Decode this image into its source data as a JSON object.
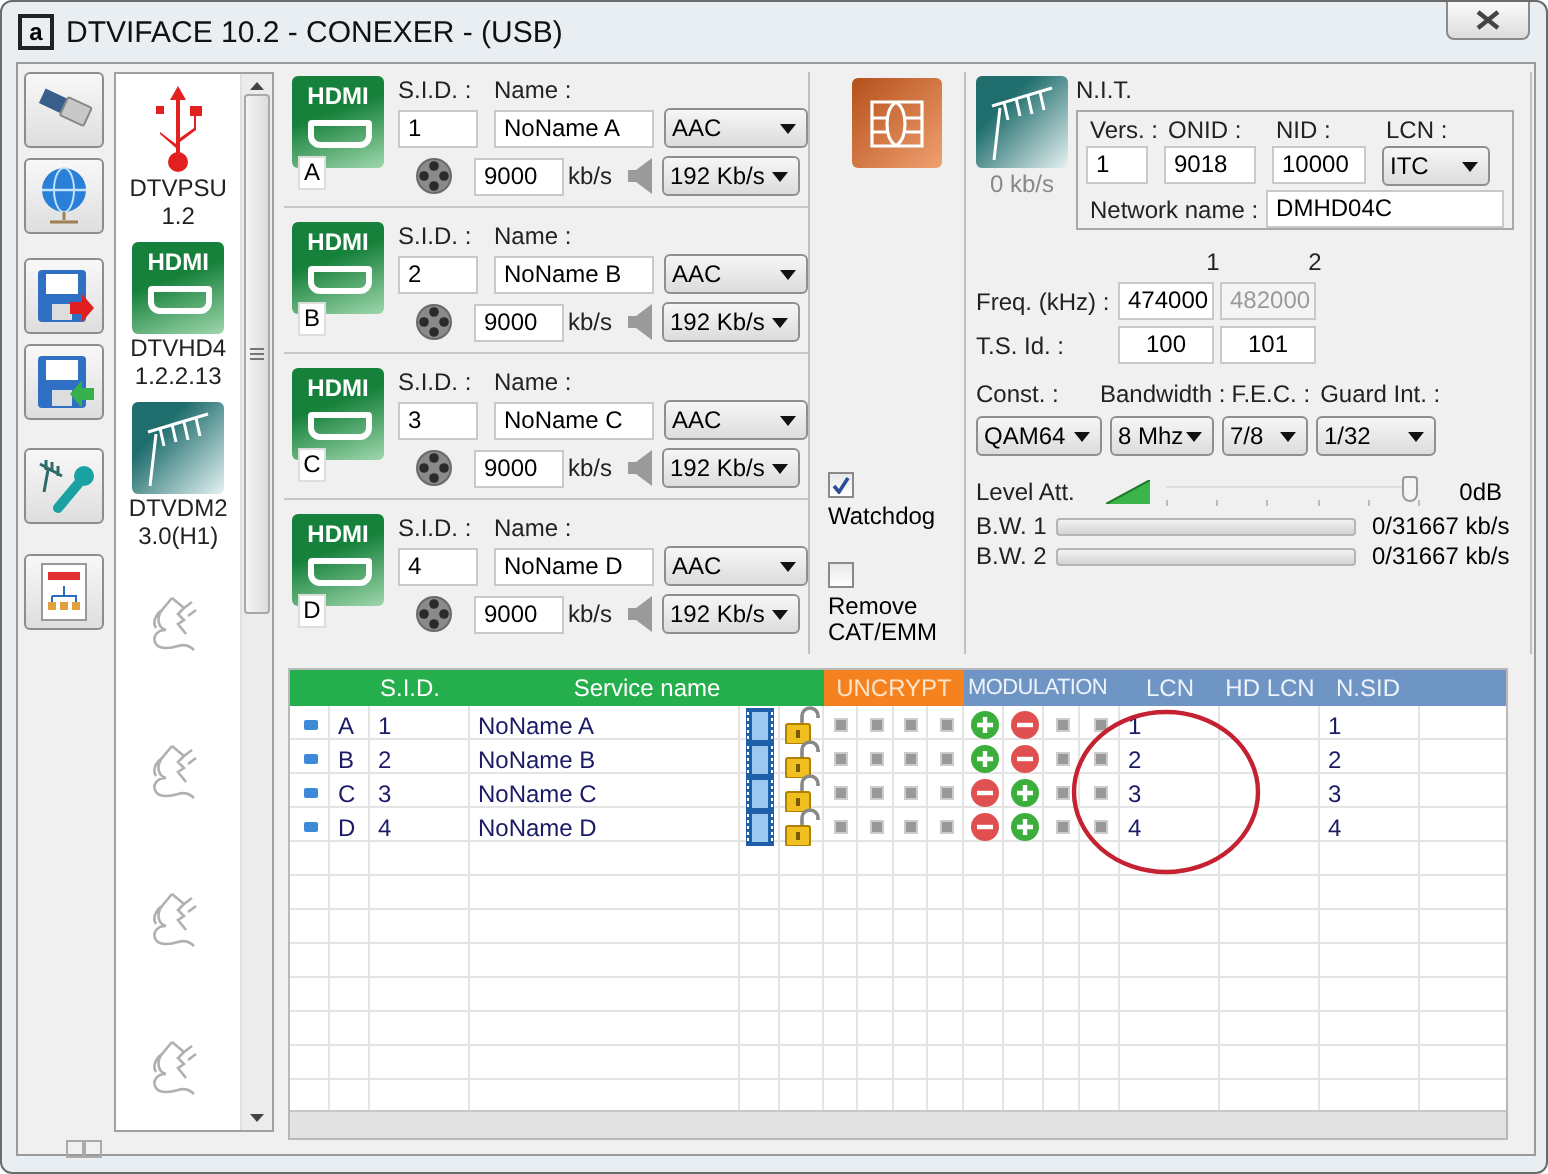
{
  "window": {
    "icon_letter": "a",
    "title": "DTVIFACE 10.2 - CONEXER - (USB)"
  },
  "toolbar": [
    {
      "kind": "usb"
    },
    {
      "kind": "network"
    },
    {
      "kind": "save"
    },
    {
      "kind": "load"
    },
    {
      "kind": "antenna"
    },
    {
      "kind": "report"
    }
  ],
  "devices": [
    {
      "kind": "usb",
      "name": "DTVPSU",
      "version": "1.2"
    },
    {
      "kind": "hdmi",
      "logo": "HDMI",
      "name": "DTVHD4",
      "version": "1.2.2.13"
    },
    {
      "kind": "antenna",
      "name": "DTVDM2",
      "version": "3.0(H1)"
    },
    {
      "kind": "empty"
    },
    {
      "kind": "empty"
    },
    {
      "kind": "empty"
    },
    {
      "kind": "empty"
    }
  ],
  "channels": [
    {
      "logo": "HDMI",
      "port": "A",
      "sid_label": "S.I.D. :",
      "sid": "1",
      "name_label": "Name :",
      "name": "NoName A",
      "audio": "AAC",
      "bitrate": "9000",
      "unit": "kb/s",
      "audio_rate": "192 Kb/s"
    },
    {
      "logo": "HDMI",
      "port": "B",
      "sid_label": "S.I.D. :",
      "sid": "2",
      "name_label": "Name :",
      "name": "NoName B",
      "audio": "AAC",
      "bitrate": "9000",
      "unit": "kb/s",
      "audio_rate": "192 Kb/s"
    },
    {
      "logo": "HDMI",
      "port": "C",
      "sid_label": "S.I.D. :",
      "sid": "3",
      "name_label": "Name :",
      "name": "NoName C",
      "audio": "AAC",
      "bitrate": "9000",
      "unit": "kb/s",
      "audio_rate": "192 Kb/s"
    },
    {
      "logo": "HDMI",
      "port": "D",
      "sid_label": "S.I.D. :",
      "sid": "4",
      "name_label": "Name :",
      "name": "NoName D",
      "audio": "AAC",
      "bitrate": "9000",
      "unit": "kb/s",
      "audio_rate": "192 Kb/s"
    }
  ],
  "options": [
    {
      "label": "Watchdog",
      "checked": true
    },
    {
      "label": "Remove CAT/EMM",
      "checked": false
    }
  ],
  "modulator": {
    "rate": "0 kb/s",
    "nit": {
      "title": "N.I.T.",
      "vers_label": "Vers. :",
      "vers": "1",
      "onid_label": "ONID :",
      "onid": "9018",
      "nid_label": "NID :",
      "nid": "10000",
      "lcn_label": "LCN :",
      "lcn": "ITC",
      "network_name_label": "Network name :",
      "network_name": "DMHD04C"
    },
    "columns": [
      "1",
      "2"
    ],
    "freq_label": "Freq. (kHz) :",
    "freq": [
      {
        "value": "474000",
        "disabled": false
      },
      {
        "value": "482000",
        "disabled": true
      }
    ],
    "ts_label": "T.S. Id. :",
    "ts": [
      "100",
      "101"
    ],
    "settings": [
      {
        "label": "Const. :",
        "value": "QAM64"
      },
      {
        "label": "Bandwidth :",
        "value": "8 Mhz"
      },
      {
        "label": "F.E.C. :",
        "value": "7/8"
      },
      {
        "label": "Guard Int. :",
        "value": "1/32"
      }
    ],
    "level_att": {
      "label": "Level Att.",
      "level": 1,
      "reading": "0dB"
    },
    "bandwidth": [
      {
        "label": "B.W. 1",
        "level": 0,
        "reading": "0/31667 kb/s"
      },
      {
        "label": "B.W. 2",
        "level": 0,
        "reading": "0/31667 kb/s"
      }
    ]
  },
  "table": {
    "columns": [
      {
        "label": "S.I.D.",
        "color": "#25ae4c"
      },
      {
        "label": "Service name",
        "color": "#25ae4c"
      },
      {
        "label": "UNCRYPT",
        "color": "#f5821f"
      },
      {
        "label": "MODULATION",
        "color": "#6f95c5"
      },
      {
        "label": "LCN",
        "color": "#6f95c5"
      },
      {
        "label": "HD LCN",
        "color": "#6f95c5"
      },
      {
        "label": "N.SID",
        "color": "#6f95c5"
      }
    ],
    "rows": [
      {
        "port": "A",
        "sid": "1",
        "name": "NoName A",
        "modulation": [
          {
            "kind": "plus"
          },
          {
            "kind": "minus"
          }
        ],
        "lcn": "1",
        "nsid": "1"
      },
      {
        "port": "B",
        "sid": "2",
        "name": "NoName B",
        "modulation": [
          {
            "kind": "plus"
          },
          {
            "kind": "minus"
          }
        ],
        "lcn": "2",
        "nsid": "2"
      },
      {
        "port": "C",
        "sid": "3",
        "name": "NoName C",
        "modulation": [
          {
            "kind": "minus"
          },
          {
            "kind": "plus"
          }
        ],
        "lcn": "3",
        "nsid": "3"
      },
      {
        "port": "D",
        "sid": "4",
        "name": "NoName D",
        "modulation": [
          {
            "kind": "minus"
          },
          {
            "kind": "plus"
          }
        ],
        "lcn": "4",
        "nsid": "4"
      }
    ]
  }
}
